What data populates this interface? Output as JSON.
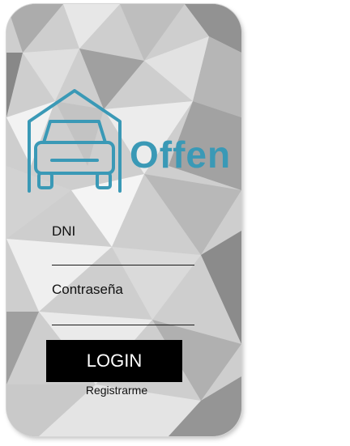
{
  "app": {
    "brand": "Offen",
    "brand_color": "#3a99b6"
  },
  "form": {
    "dni_label": "DNI",
    "dni_value": "",
    "password_label": "Contraseña",
    "password_value": "",
    "login_label": "LOGIN",
    "register_label": "Registrarme"
  },
  "icons": {
    "logo": "car-in-garage-icon"
  }
}
